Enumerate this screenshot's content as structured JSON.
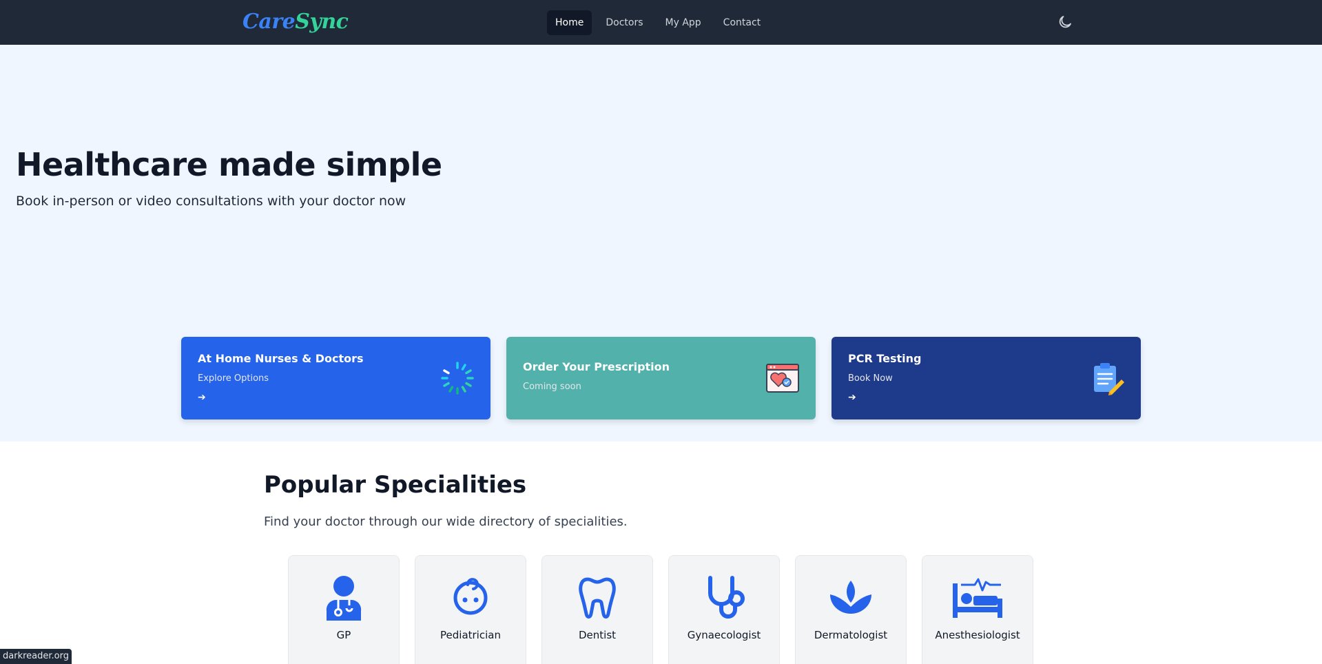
{
  "header": {
    "logo_part1": "Care",
    "logo_part2": "Sync",
    "nav": [
      {
        "label": "Home",
        "active": true
      },
      {
        "label": "Doctors",
        "active": false
      },
      {
        "label": "My App",
        "active": false
      },
      {
        "label": "Contact",
        "active": false
      }
    ],
    "theme_toggle_icon": "moon-icon"
  },
  "hero": {
    "title": "Healthcare made simple",
    "subtitle": "Book in-person or video consultations with your doctor now"
  },
  "cards": [
    {
      "title": "At Home Nurses & Doctors",
      "subtitle": "Explore Options",
      "arrow": "➔",
      "icon": "loading-spinner-icon",
      "color": "#2563eb"
    },
    {
      "title": "Order Your Prescription",
      "subtitle": "Coming soon",
      "icon": "prescription-heart-icon",
      "color": "#52b1aa"
    },
    {
      "title": "PCR Testing",
      "subtitle": "Book Now",
      "arrow": "➔",
      "icon": "clipboard-pencil-icon",
      "color": "#1e3a8a"
    }
  ],
  "specialities": {
    "title": "Popular Specialities",
    "subtitle": "Find your doctor through our wide directory of specialities.",
    "items": [
      {
        "label": "GP",
        "icon": "doctor-icon"
      },
      {
        "label": "Pediatrician",
        "icon": "baby-icon"
      },
      {
        "label": "Dentist",
        "icon": "tooth-icon"
      },
      {
        "label": "Gynaecologist",
        "icon": "stethoscope-icon"
      },
      {
        "label": "Dermatologist",
        "icon": "lotus-icon"
      },
      {
        "label": "Anesthesiologist",
        "icon": "hospital-bed-icon"
      }
    ]
  },
  "badge": "darkreader.org",
  "colors": {
    "accent": "#2563eb",
    "icon_blue": "#2563eb",
    "header_bg": "#1f2937",
    "hero_bg": "#eff6ff"
  }
}
